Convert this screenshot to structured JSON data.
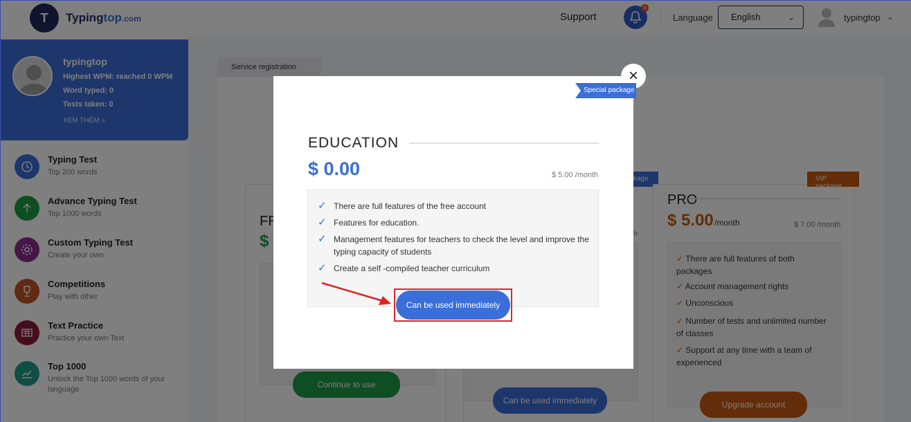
{
  "header": {
    "logo_text_main": "Typing",
    "logo_text_accent": "top",
    "logo_text_suffix": ".com",
    "support": "Support",
    "notification_count": "0",
    "language_label": "Language",
    "language_value": "English",
    "username": "typingtop"
  },
  "profile": {
    "name": "typingtop",
    "highest_wpm": "Highest WPM: reached 0 WPM",
    "words_typed": "Word typed: 0",
    "tests_taken": "Tests taken: 0",
    "more": "XEM THÊM"
  },
  "menu": [
    {
      "title": "Typing Test",
      "sub": "Top 200 words",
      "icon": "clock-icon",
      "color": "#3a6ed8"
    },
    {
      "title": "Advance Typing Test",
      "sub": "Top 1000 words",
      "icon": "arrow-up-icon",
      "color": "#1e9a45"
    },
    {
      "title": "Custom Typing Test",
      "sub": "Create your own",
      "icon": "gear-icon",
      "color": "#8a2f8a"
    },
    {
      "title": "Competitions",
      "sub": "Play with other",
      "icon": "trophy-icon",
      "color": "#c45326"
    },
    {
      "title": "Text Practice",
      "sub": "Practice your own Text",
      "icon": "keyboard-icon",
      "color": "#8a1a3a"
    },
    {
      "title": "Top 1000",
      "sub": "Unlock the Top 1000 words of your language",
      "icon": "chart-icon",
      "color": "#1e9a8a"
    }
  ],
  "tab": {
    "label": "Service registration"
  },
  "background_plans": {
    "free": {
      "title_partial": "FR",
      "price_partial": "$ (",
      "button": "Continue to use"
    },
    "education": {
      "ribbon_partial": "kage",
      "button": "Can be used immediately",
      "month_partial": "h"
    },
    "pro": {
      "ribbon": "VIP package",
      "title": "PRO",
      "price": "$ 5.00",
      "per_month": "/month",
      "old_price": "$ 7.00 /month",
      "features": [
        "There are full features of both packages",
        "Account management rights",
        "Unconscious",
        "Number of tests and unlimited number of classes",
        "Support at any time with a team of experienced"
      ],
      "button": "Upgrade account"
    }
  },
  "modal": {
    "ribbon": "Special package",
    "title": "EDUCATION",
    "price": "$ 0.00",
    "old_price": "$ 5.00 /month",
    "features": [
      "There are full features of the free account",
      "Features for education.",
      "Management features for teachers to check the level and improve the typing capacity of students",
      "Create a self -compiled teacher curriculum"
    ],
    "cta": "Can be used immediately",
    "close": "×"
  },
  "colors": {
    "primary": "#3a6ed8",
    "green": "#1e9a45",
    "orange": "#c45a10",
    "highlight": "#d8282a"
  }
}
